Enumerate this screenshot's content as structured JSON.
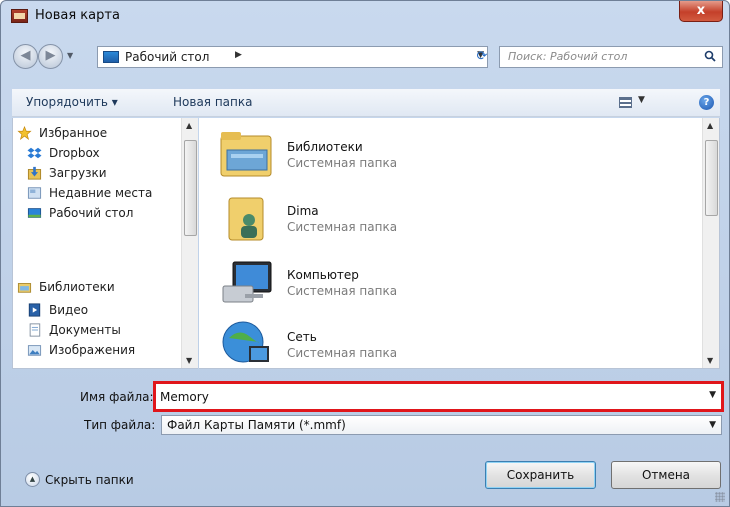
{
  "window": {
    "title": "Новая карта",
    "close_symbol": "x"
  },
  "nav": {
    "back_symbol": "◀",
    "forward_symbol": "▶",
    "address_text": "Рабочий стол",
    "address_chevron": "▶",
    "search_placeholder": "Поиск: Рабочий стол"
  },
  "toolbar": {
    "organize_label": "Упорядочить ▾",
    "new_folder_label": "Новая папка",
    "help_symbol": "?"
  },
  "sidebar": {
    "items": [
      {
        "label": "Избранное",
        "icon": "star-icon"
      },
      {
        "label": "Dropbox",
        "icon": "dropbox-icon"
      },
      {
        "label": "Загрузки",
        "icon": "downloads-icon"
      },
      {
        "label": "Недавние места",
        "icon": "recent-places-icon"
      },
      {
        "label": "Рабочий стол",
        "icon": "desktop-icon"
      },
      {
        "label": "Библиотеки",
        "icon": "libraries-icon"
      },
      {
        "label": "Видео",
        "icon": "video-icon"
      },
      {
        "label": "Документы",
        "icon": "documents-icon"
      },
      {
        "label": "Изображения",
        "icon": "pictures-icon"
      }
    ]
  },
  "files": [
    {
      "name": "Библиотеки",
      "type": "Системная папка",
      "icon": "libraries-folder-icon"
    },
    {
      "name": "Dima",
      "type": "Системная папка",
      "icon": "user-folder-icon"
    },
    {
      "name": "Компьютер",
      "type": "Системная папка",
      "icon": "computer-icon"
    },
    {
      "name": "Сеть",
      "type": "Системная папка",
      "icon": "network-icon"
    }
  ],
  "form": {
    "filename_label": "Имя файла:",
    "filename_value": "Memory",
    "filetype_label": "Тип файла:",
    "filetype_value": "Файл Карты Памяти (*.mmf)"
  },
  "footer": {
    "hide_folders_label": "Скрыть папки",
    "save_label": "Сохранить",
    "cancel_label": "Отмена"
  },
  "colors": {
    "highlight_border": "#e0161b",
    "title_bar": "#c9d9ee",
    "close_button": "#c4402a"
  }
}
